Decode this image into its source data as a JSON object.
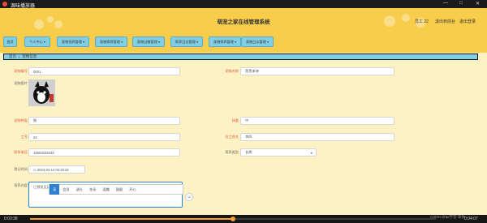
{
  "player": {
    "title": "源味播放器",
    "window_controls": [
      "—",
      "□",
      "✕"
    ],
    "time_current": "0:03:38",
    "time_total": "0:04:07",
    "progress": 0.5,
    "watermark": "CSDN @tp/学堂 等你"
  },
  "header": {
    "title": "萌宠之家在线管理系统",
    "user_label": "员工 22",
    "login_link": "退出到前台",
    "logout_link": "退出登录"
  },
  "nav": {
    "home": "首页",
    "personal": "个人中心",
    "menus": [
      "宠物领养管理",
      "宠物寄养管理",
      "宠物过敏管理",
      "寄养日志管理",
      "宠物寄养管理",
      "宠物日志管理"
    ]
  },
  "breadcrumb": {
    "root": "首页",
    "current": "宠物信息"
  },
  "form": {
    "pet_id_label": "宠物编号",
    "pet_id_value": "0001",
    "pet_name_label": "宠物名称",
    "pet_name_value": "黑黑漆漆",
    "pet_photo_label": "宠物图片",
    "species_label": "宠物种类",
    "species_value": "狗",
    "weight_label": "体重",
    "weight_value": "中",
    "employee_id_label": "工号",
    "employee_id_value": "22",
    "employee_name_label": "员工姓名",
    "employee_name_value": "李四",
    "phone_label": "联系电话",
    "phone_value": "15503333333",
    "status_label": "寄养类型",
    "status_value": "长期",
    "time_label": "登记时间",
    "time_value": "2022-04-14 04:33:22",
    "note_label": "寄养内容",
    "note_value": "已预览至[Joyis]"
  },
  "emoji_bar": {
    "items": [
      "宠",
      "会员",
      "送礼",
      "花朵",
      "逗趣",
      "鼓励",
      "开心"
    ],
    "active": 0
  }
}
